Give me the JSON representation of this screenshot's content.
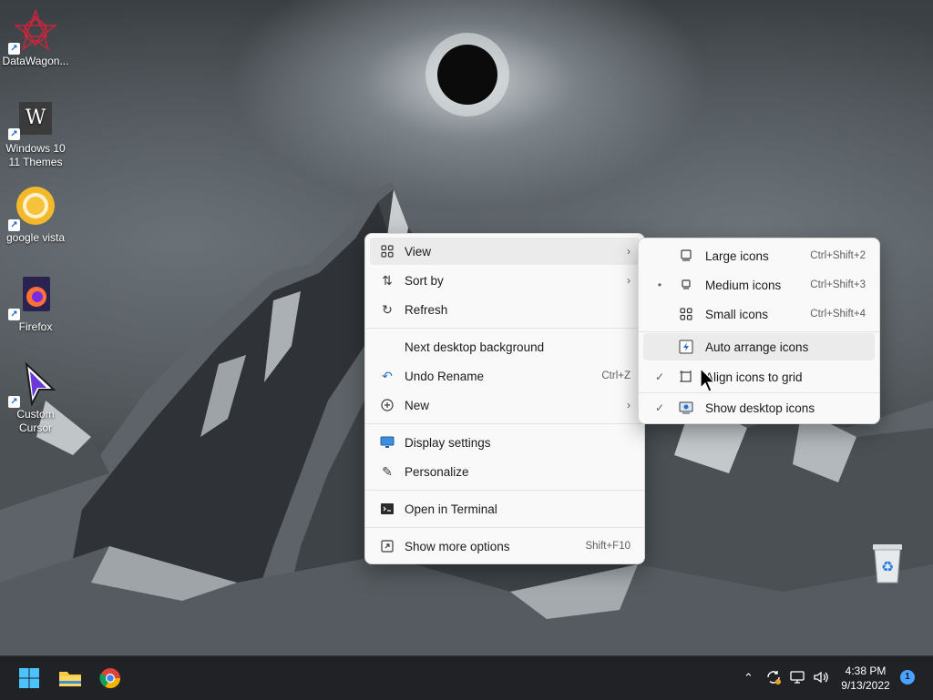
{
  "desktop": {
    "icons": [
      {
        "label": "DataWagon...",
        "icon": "datawagon-icon"
      },
      {
        "label": "Windows 10 11 Themes",
        "icon": "windows-themes-icon",
        "glyph": "W"
      },
      {
        "label": "google vista",
        "icon": "chrome-vista-icon"
      },
      {
        "label": "Firefox",
        "icon": "firefox-icon"
      },
      {
        "label": "Custom Cursor",
        "icon": "custom-cursor-icon"
      }
    ],
    "recycle_bin_icon": "recycle-bin-icon"
  },
  "context_menu": {
    "items": [
      {
        "label": "View",
        "icon": "grid-icon",
        "submenu": true,
        "highlighted": true
      },
      {
        "label": "Sort by",
        "icon": "sort-icon",
        "submenu": true
      },
      {
        "label": "Refresh",
        "icon": "refresh-icon"
      },
      {
        "label": "Next desktop background",
        "icon": ""
      },
      {
        "label": "Undo Rename",
        "icon": "undo-icon",
        "shortcut": "Ctrl+Z"
      },
      {
        "label": "New",
        "icon": "plus-circle-icon",
        "submenu": true
      },
      {
        "label": "Display settings",
        "icon": "display-icon"
      },
      {
        "label": "Personalize",
        "icon": "brush-icon"
      },
      {
        "label": "Open in Terminal",
        "icon": "terminal-icon"
      },
      {
        "label": "Show more options",
        "icon": "expand-icon",
        "shortcut": "Shift+F10"
      }
    ]
  },
  "view_submenu": {
    "items": [
      {
        "label": "Large icons",
        "icon": "large-icons-icon",
        "shortcut": "Ctrl+Shift+2",
        "marker": ""
      },
      {
        "label": "Medium icons",
        "icon": "medium-icons-icon",
        "shortcut": "Ctrl+Shift+3",
        "marker": "•"
      },
      {
        "label": "Small icons",
        "icon": "small-icons-icon",
        "shortcut": "Ctrl+Shift+4",
        "marker": ""
      },
      {
        "label": "Auto arrange icons",
        "icon": "auto-arrange-icon",
        "marker": "",
        "highlighted": true
      },
      {
        "label": "Align icons to grid",
        "icon": "align-grid-icon",
        "marker": "✓"
      },
      {
        "label": "Show desktop icons",
        "icon": "show-desktop-icon",
        "marker": "✓"
      }
    ]
  },
  "taskbar": {
    "pinned": [
      "windows-start-icon",
      "file-explorer-icon",
      "chrome-icon"
    ],
    "tray_icons": [
      "chevron-up-icon",
      "sync-icon",
      "network-icon",
      "volume-icon"
    ],
    "time": "4:38 PM",
    "date": "9/13/2022",
    "notification_count": "1"
  },
  "colors": {
    "accent": "#0067c0",
    "menu_bg": "#f9f9f9",
    "taskbar_bg": "#202226"
  }
}
